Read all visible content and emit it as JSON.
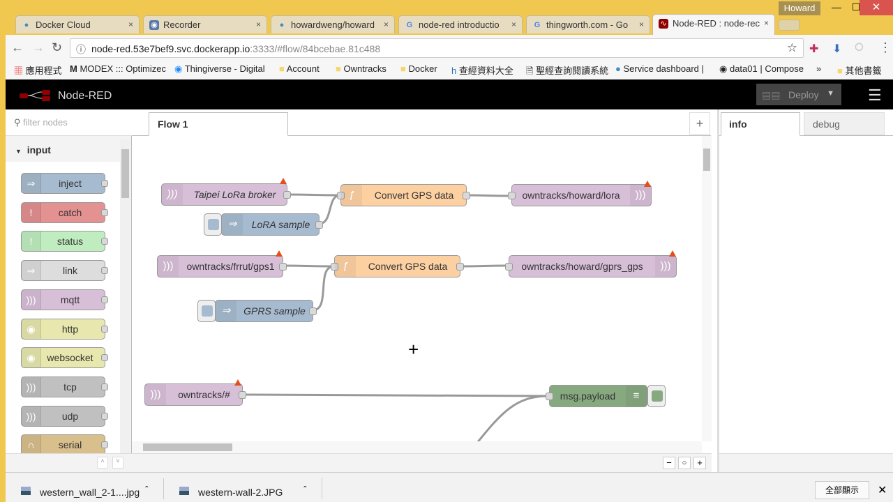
{
  "browser": {
    "profile": "Howard",
    "tabs": [
      {
        "title": "Docker Cloud",
        "icon": "docker-icon"
      },
      {
        "title": "Recorder",
        "icon": "recorder-icon"
      },
      {
        "title": "howardweng/howard",
        "icon": "docker-icon"
      },
      {
        "title": "node-red introductio",
        "icon": "google-icon"
      },
      {
        "title": "thingworth.com - Go",
        "icon": "google-icon"
      },
      {
        "title": "Node-RED : node-rec",
        "icon": "node-red-icon"
      }
    ],
    "url_host": "node-red.53e7bef9.svc.dockerapp.io",
    "url_rest": ":3333/#flow/84bcebae.81c488",
    "bookmarks": [
      "應用程式",
      "MODEX ::: Optimizec",
      "Thingiverse - Digital",
      "Account",
      "Owntracks",
      "Docker",
      "查經資料大全",
      "聖經查詢閱讀系統",
      "Service dashboard |",
      "data01 | Compose",
      "»",
      "其他書籤"
    ]
  },
  "app": {
    "title": "Node-RED",
    "deploy": "Deploy"
  },
  "palette": {
    "filter_placeholder": "filter nodes",
    "category": "input",
    "nodes": [
      {
        "label": "inject",
        "color": "#a6bbcf"
      },
      {
        "label": "catch",
        "color": "#e49191"
      },
      {
        "label": "status",
        "color": "#c0edc0"
      },
      {
        "label": "link",
        "color": "#dddddd"
      },
      {
        "label": "mqtt",
        "color": "#d8bfd8"
      },
      {
        "label": "http",
        "color": "#e7e7ae"
      },
      {
        "label": "websocket",
        "color": "#e7e7ae"
      },
      {
        "label": "tcp",
        "color": "#c0c0c0"
      },
      {
        "label": "udp",
        "color": "#c0c0c0"
      },
      {
        "label": "serial",
        "color": "#d8bf8c"
      }
    ]
  },
  "workspace": {
    "tab": "Flow 1",
    "nodes": {
      "n1": "Taipei LoRa broker",
      "n2": "LoRA sample",
      "n3": "Convert GPS data",
      "n4": "owntracks/howard/lora",
      "n5": "owntracks/frrut/gps1",
      "n6": "Convert GPS data",
      "n7": "owntracks/howard/gprs_gps",
      "n8": "GPRS sample",
      "n9": "owntracks/#",
      "n10": "msg.payload"
    }
  },
  "sidebar": {
    "tabs": [
      "info",
      "debug"
    ]
  },
  "downloads": {
    "items": [
      "western_wall_2-1....jpg",
      "western-wall-2.JPG"
    ],
    "show_all": "全部顯示"
  }
}
